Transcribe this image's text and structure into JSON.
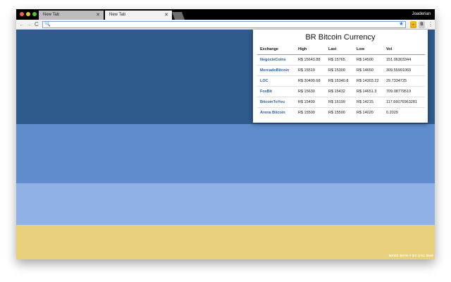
{
  "browser": {
    "tabs": [
      {
        "label": "New Tab",
        "close": "✕"
      },
      {
        "label": "New Tab",
        "close": "✕"
      }
    ],
    "profile_name": "Joaderian",
    "nav": {
      "back": "←",
      "forward": "→",
      "reload": "C"
    },
    "search_glyph": "🔍",
    "star_glyph": "★",
    "menu_glyph": "⋮",
    "extensions": [
      {
        "icon": "cat-icon",
        "glyph": "🐱"
      },
      {
        "icon": "bitcoin-icon",
        "glyph": "B"
      }
    ]
  },
  "popup": {
    "title": "BR Bitcoin Currency",
    "columns": [
      "Exchange",
      "High",
      "Last",
      "Low",
      "Vol"
    ],
    "rows": [
      {
        "exchange": "NegocieCoins",
        "high": "R$ 15643.88",
        "last": "R$ 15765",
        "low": "R$ 14500",
        "vol": "151.06303344"
      },
      {
        "exchange": "MercadoBitcoin",
        "high": "R$ 15519",
        "last": "R$ 15300",
        "low": "R$ 14650",
        "vol": "309.55991069"
      },
      {
        "exchange": "LOC",
        "high": "R$ 30400.68",
        "last": "R$ 15340.8",
        "low": "R$ 14303.22",
        "vol": "29.7334725"
      },
      {
        "exchange": "FoxBit",
        "high": "R$ 15630",
        "last": "R$ 15432",
        "low": "R$ 14651.3",
        "vol": "709.08779519"
      },
      {
        "exchange": "BitcoinToYou",
        "high": "R$ 15499",
        "last": "R$ 15199",
        "low": "R$ 14215",
        "vol": "117.66076963281"
      },
      {
        "exchange": "Arena Bitcoin",
        "high": "R$ 15500",
        "last": "R$ 15500",
        "low": "R$ 14020",
        "vol": "0.2029"
      }
    ]
  },
  "page": {
    "made_with": "MADE WITH ♥ BY GAL BHR",
    "band_colors": [
      "#2e5a8c",
      "#5f8ccc",
      "#8fb1e5",
      "#e8d07d"
    ]
  }
}
